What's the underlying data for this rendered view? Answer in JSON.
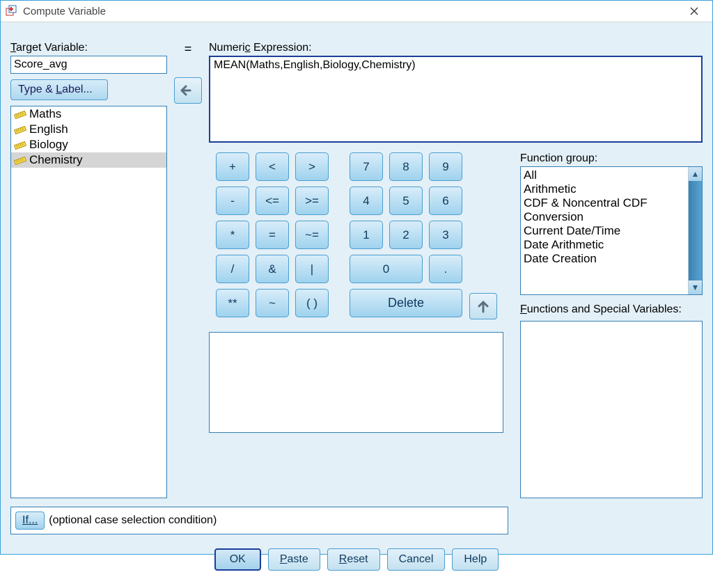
{
  "window": {
    "title": "Compute Variable"
  },
  "labels": {
    "target": "Target Variable:",
    "expr": "Numeric Expression:",
    "type_label": "Type & Label...",
    "equals": "=",
    "fn_group": "Function group:",
    "fn_special": "Functions and Special Variables:",
    "if_btn": "If...",
    "if_text": "(optional case selection condition)"
  },
  "target": {
    "value": "Score_avg"
  },
  "expression": "MEAN(Maths,English,Biology,Chemistry)",
  "variables": [
    {
      "name": "Maths",
      "selected": false
    },
    {
      "name": "English",
      "selected": false
    },
    {
      "name": "Biology",
      "selected": false
    },
    {
      "name": "Chemistry",
      "selected": true
    }
  ],
  "keypad": {
    "r1": [
      "+",
      "<",
      ">",
      "7",
      "8",
      "9"
    ],
    "r2": [
      "-",
      "<=",
      ">=",
      "4",
      "5",
      "6"
    ],
    "r3": [
      "*",
      "=",
      "~=",
      "1",
      "2",
      "3"
    ],
    "r4": [
      "/",
      "&",
      "|",
      "0",
      "."
    ],
    "r5": [
      "**",
      "~",
      "( )",
      "Delete"
    ]
  },
  "function_groups": [
    "All",
    "Arithmetic",
    "CDF & Noncentral CDF",
    "Conversion",
    "Current Date/Time",
    "Date Arithmetic",
    "Date Creation"
  ],
  "footer": {
    "ok": "OK",
    "paste": "Paste",
    "reset": "Reset",
    "cancel": "Cancel",
    "help": "Help"
  }
}
